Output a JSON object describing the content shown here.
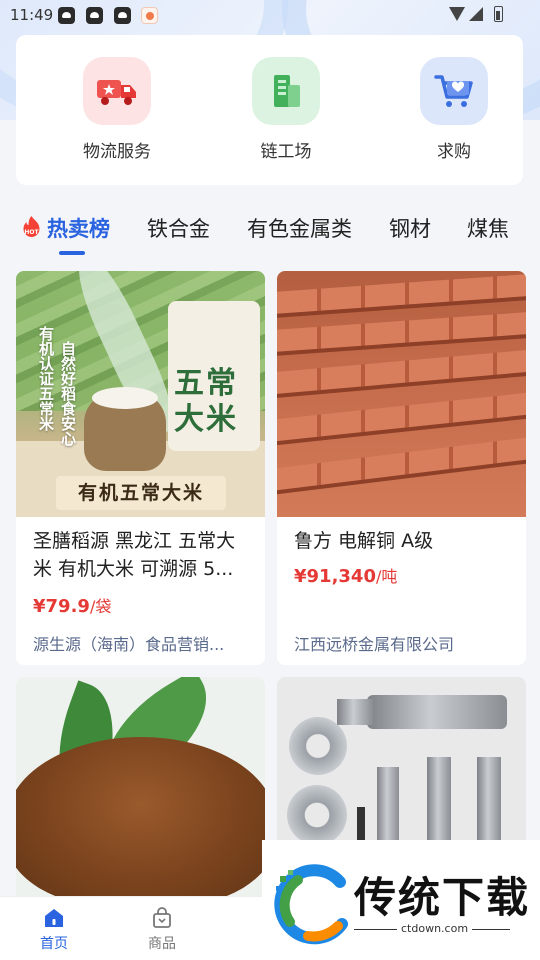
{
  "status_bar": {
    "time": "11:49"
  },
  "services": [
    {
      "label": "物流服务",
      "icon": "truck-icon"
    },
    {
      "label": "链工场",
      "icon": "building-icon"
    },
    {
      "label": "求购",
      "icon": "cart-heart-icon"
    }
  ],
  "tabs": {
    "hot_badge": "HOT",
    "items": [
      "热卖榜",
      "铁合金",
      "有色金属类",
      "钢材",
      "煤焦"
    ],
    "active": "热卖榜"
  },
  "products": [
    {
      "title": "圣膳稻源 黑龙江 五常大米 有机大米 可溯源 5...",
      "price": "¥79.9",
      "unit": "/袋",
      "seller": "源生源（海南）食品营销...",
      "image_text": {
        "banner": "有机五常大米",
        "bag": "五常大米",
        "side_left": "有机认证五常米",
        "side_right": "自然好稻食安心"
      }
    },
    {
      "title": "鲁方 电解铜 A级",
      "price": "¥91,340",
      "unit": "/吨",
      "seller": "江西远桥金属有限公司"
    },
    {
      "image": "brown-powder-with-leaves"
    },
    {
      "image": "metal-tooling-parts"
    }
  ],
  "bottom_nav": [
    {
      "label": "首页",
      "icon": "home-icon",
      "active": true
    },
    {
      "label": "商品",
      "icon": "bag-icon",
      "active": false
    }
  ],
  "watermark": {
    "text": "传统下载",
    "url": "ctdown.com"
  },
  "colors": {
    "accent": "#2a63e0",
    "price": "#e53935",
    "seller": "#5a6a8c"
  }
}
